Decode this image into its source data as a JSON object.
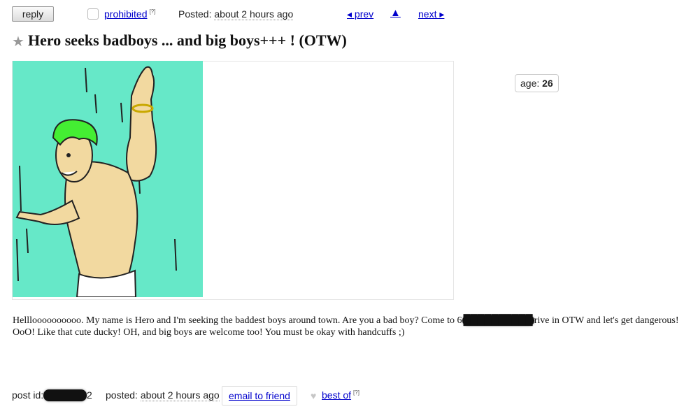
{
  "toolbar": {
    "reply_label": "reply",
    "prohibited_label": "prohibited",
    "prohibited_help": "[?]",
    "posted_label": "Posted:",
    "posted_time": "about 2 hours ago",
    "prev_label": "◂ prev",
    "up_label": "▲",
    "next_label": "next ▸"
  },
  "post": {
    "title": "Hero seeks badboys ... and big boys+++ ! (OTW)",
    "age_label": "age:",
    "age_value": "26",
    "body_line1_start": "Hellloooooooooo. My name is Hero and I'm seeking the baddest boys around town. Are you a bad boy? Come to 6",
    "body_line1_redacted": "██████████",
    "body_line1_end": "rive in OTW and let's get dangerous!",
    "body_line2": "OoO! Like that cute ducky! OH, and big boys are welcome too! You must be okay with handcuffs ;)"
  },
  "footer": {
    "post_id_label": "post id:",
    "post_id_tail": "2",
    "posted_label": "posted:",
    "posted_time": "about 2 hours ago",
    "email_label": "email to friend",
    "best_of_label": "best of",
    "best_of_help": "[?]"
  },
  "colors": {
    "link": "#0000cc",
    "image_background": "#66e8c8",
    "hair": "#44ee33"
  }
}
